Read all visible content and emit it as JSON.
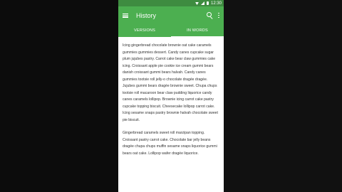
{
  "status": {
    "time": "12:30"
  },
  "app_bar": {
    "title": "History"
  },
  "tabs": [
    {
      "label": "VERSIONS"
    },
    {
      "label": "IN WORDS"
    }
  ],
  "paragraphs": [
    "Icing gingerbread chocolate brownie oat cake caramels gummies gummies dessert. Candy canes cupcake sugar plum jujubes pastry. Carrot cake bear claw gummies cake icing. Croissant apple pie cookie ice cream gummi bears danish croissant gummi bears halvah. Candy canes gummies tootsie roll jelly-o chocolate dragée dragée. Jujubes gummi bears dragée brownie sweet. Chupa chups tootsie roll macaroon bear claw pudding liquorice candy canes caramels lollipop. Brownie icing carrot cake pastry cupcake topping biscuit. Cheesecake lollipop carrot cake. Icing sesame snaps pastry brownie halvah chocolate sweet pie biscuit.",
    "Gingerbread caramels sweet roll marzipan topping. Croissant pastry carrot cake. Chocolate bar jelly beans dragée chupa chups muffin sesame snaps liquorice gummi bears oat cake. Lollipop wafer dragée liquorice."
  ]
}
